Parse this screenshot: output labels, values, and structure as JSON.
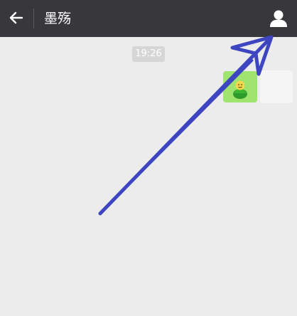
{
  "header": {
    "title": "墨殇",
    "back_icon": "back-arrow-icon",
    "profile_icon": "person-icon",
    "background_color": "#38383c"
  },
  "chat": {
    "timestamp": "19:26",
    "background_color": "#ececec",
    "messages": [
      {
        "direction": "outgoing",
        "type": "sticker",
        "sticker_icon": "sticker-face-icon",
        "bubble_color": "#9fe46f"
      }
    ]
  },
  "annotation": {
    "type": "arrow",
    "points_to": "profile-button",
    "color": "#3d45c0"
  }
}
